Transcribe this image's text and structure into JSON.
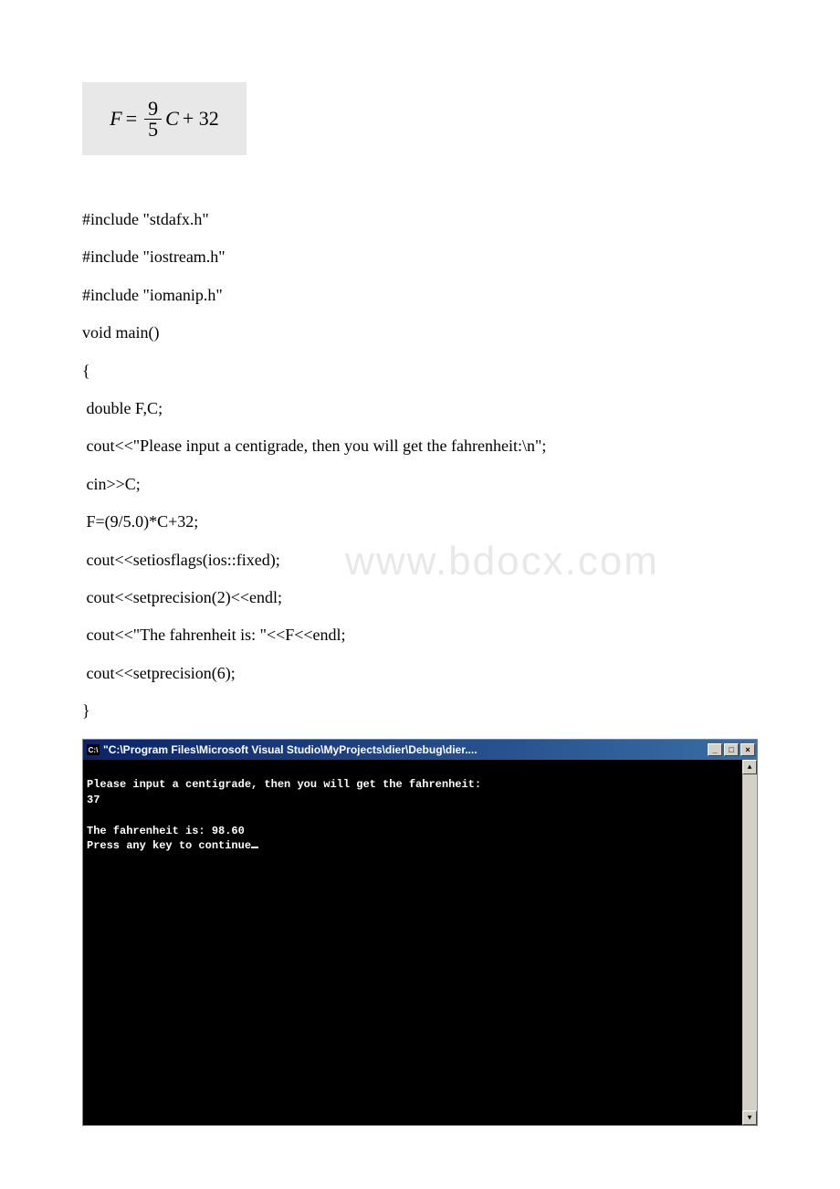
{
  "formula": {
    "lhs": "F",
    "eq": "=",
    "num": "9",
    "den": "5",
    "var": "C",
    "plus": "+ 32"
  },
  "code": [
    "#include \"stdafx.h\"",
    "#include \"iostream.h\"",
    "#include \"iomanip.h\"",
    "void main()",
    "{",
    " double F,C;",
    " cout<<\"Please input a centigrade, then you will get the fahrenheit:\\n\";",
    " cin>>C;",
    " F=(9/5.0)*C+32;",
    " cout<<setiosflags(ios::fixed);",
    " cout<<setprecision(2)<<endl;",
    " cout<<\"The fahrenheit is: \"<<F<<endl;",
    " cout<<setprecision(6);",
    "}"
  ],
  "watermark": "www.bdocx.com",
  "console": {
    "titleIcon": "C:\\",
    "title": "\"C:\\Program Files\\Microsoft Visual Studio\\MyProjects\\dier\\Debug\\dier....",
    "buttons": {
      "min": "_",
      "max": "□",
      "close": "×"
    },
    "scroll": {
      "up": "▲",
      "down": "▼"
    },
    "lines": [
      "Please input a centigrade, then you will get the fahrenheit:",
      "37",
      "",
      "The fahrenheit is: 98.60",
      "Press any key to continue"
    ]
  }
}
